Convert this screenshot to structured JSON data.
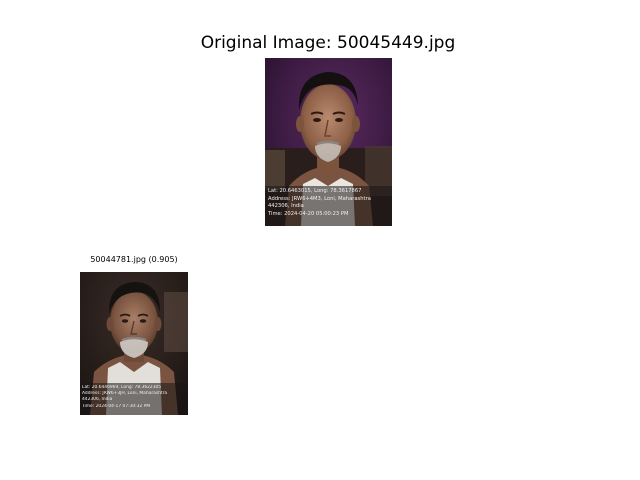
{
  "original": {
    "title": "Original Image: 50045449.jpg",
    "overlay": {
      "line1": "Lat: 20.6463015, Long: 78.3617867",
      "line2": "Address: JRW6+4M3, Loni, Maharashtra",
      "line3": "442306, India",
      "line4": "Time: 2024-04-20 05:00:23 PM"
    }
  },
  "matches": [
    {
      "title": "50044781.jpg (0.905)",
      "overlay": {
        "line1": "Lat: 20.6446969, Long: 78.3622305",
        "line2": "Address: JRW6+3JH, Loni, Maharashtra",
        "line3": "442306, India",
        "line4": "Time: 2024-04-17 07:30:32 PM"
      }
    }
  ]
}
